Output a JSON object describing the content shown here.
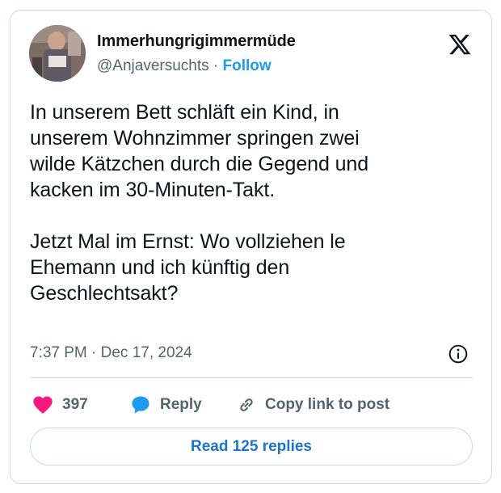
{
  "author": {
    "display_name": "Immerhungrigimmermüde",
    "handle": "@Anjaversuchts",
    "separator": "·",
    "follow_label": "Follow"
  },
  "platform_icon": "x-logo-icon",
  "tweet": {
    "paragraph1_lines": [
      "In unserem Bett schläft ein Kind, in",
      "unserem Wohnzimmer springen zwei",
      "wilde Kätzchen durch die Gegend und",
      "kacken im 30-Minuten-Takt."
    ],
    "paragraph2_lines": [
      "Jetzt Mal im Ernst: Wo vollziehen le",
      "Ehemann und ich künftig den",
      "Geschlechtsakt?"
    ],
    "timestamp": "7:37 PM · Dec 17, 2024"
  },
  "actions": {
    "like_count": "397",
    "reply_label": "Reply",
    "copy_link_label": "Copy link to post"
  },
  "read_replies_label": "Read 125 replies",
  "colors": {
    "accent": "#1d9bf0",
    "like": "#f91880",
    "reply_bubble": "#1d9bf0",
    "muted_text": "#536471",
    "border": "#cfd9de"
  }
}
